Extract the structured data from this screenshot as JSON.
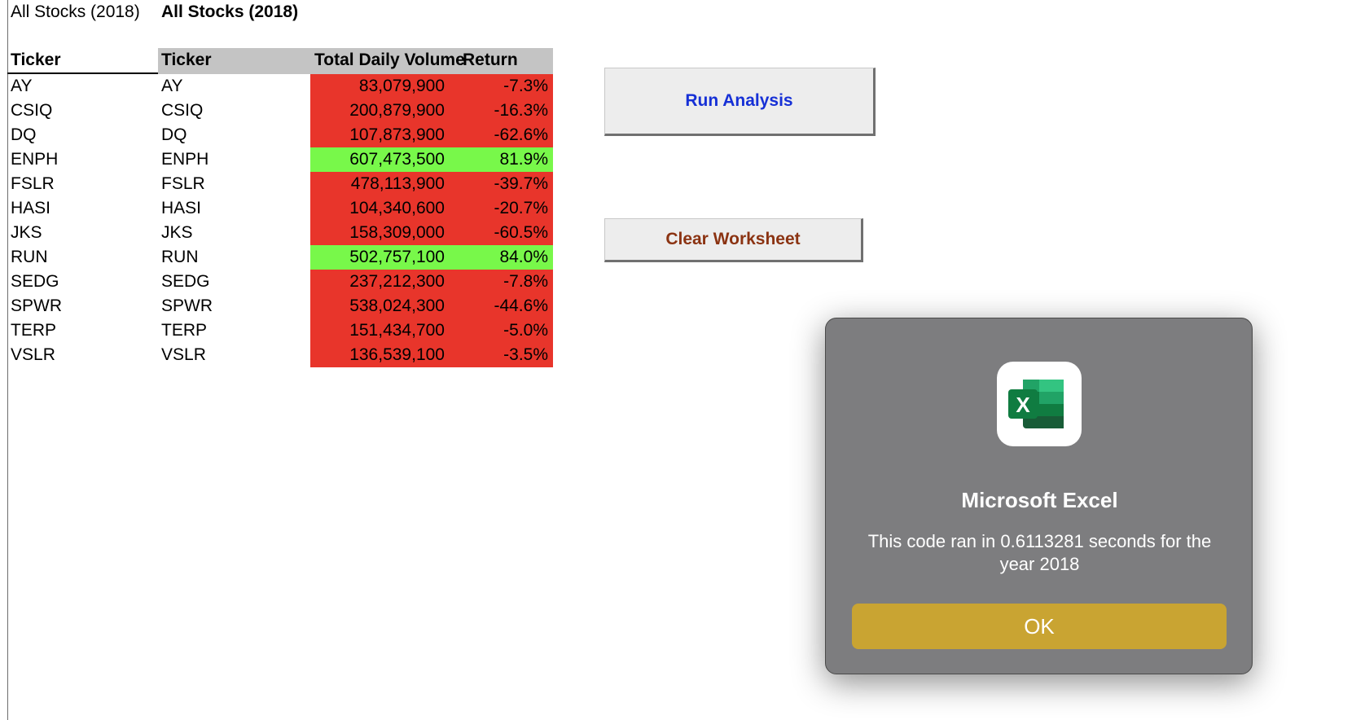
{
  "sheet": {
    "title_left": "All Stocks (2018)",
    "title_right": "All Stocks (2018)",
    "headers": {
      "ticker_left": "Ticker",
      "ticker_right": "Ticker",
      "volume": "Total Daily Volume",
      "return": "Return"
    },
    "rows": [
      {
        "ticker": "AY",
        "volume": "83,079,900",
        "return": "-7.3%",
        "status": "negative"
      },
      {
        "ticker": "CSIQ",
        "volume": "200,879,900",
        "return": "-16.3%",
        "status": "negative"
      },
      {
        "ticker": "DQ",
        "volume": "107,873,900",
        "return": "-62.6%",
        "status": "negative"
      },
      {
        "ticker": "ENPH",
        "volume": "607,473,500",
        "return": "81.9%",
        "status": "positive"
      },
      {
        "ticker": "FSLR",
        "volume": "478,113,900",
        "return": "-39.7%",
        "status": "negative"
      },
      {
        "ticker": "HASI",
        "volume": "104,340,600",
        "return": "-20.7%",
        "status": "negative"
      },
      {
        "ticker": "JKS",
        "volume": "158,309,000",
        "return": "-60.5%",
        "status": "negative"
      },
      {
        "ticker": "RUN",
        "volume": "502,757,100",
        "return": "84.0%",
        "status": "positive"
      },
      {
        "ticker": "SEDG",
        "volume": "237,212,300",
        "return": "-7.8%",
        "status": "negative"
      },
      {
        "ticker": "SPWR",
        "volume": "538,024,300",
        "return": "-44.6%",
        "status": "negative"
      },
      {
        "ticker": "TERP",
        "volume": "151,434,700",
        "return": "-5.0%",
        "status": "negative"
      },
      {
        "ticker": "VSLR",
        "volume": "136,539,100",
        "return": "-3.5%",
        "status": "negative"
      }
    ],
    "colors": {
      "negative": "#e8352b",
      "positive": "#78f84a",
      "header": "#c4c4c4"
    }
  },
  "buttons": {
    "run_analysis": "Run Analysis",
    "clear_worksheet": "Clear Worksheet",
    "run_color": "#1630d6",
    "clear_color": "#8b3312"
  },
  "dialog": {
    "icon": "excel-app-icon",
    "title": "Microsoft Excel",
    "message": "This code ran in 0.6113281 seconds for the year 2018",
    "ok": "OK",
    "ok_color": "#c9a432"
  }
}
